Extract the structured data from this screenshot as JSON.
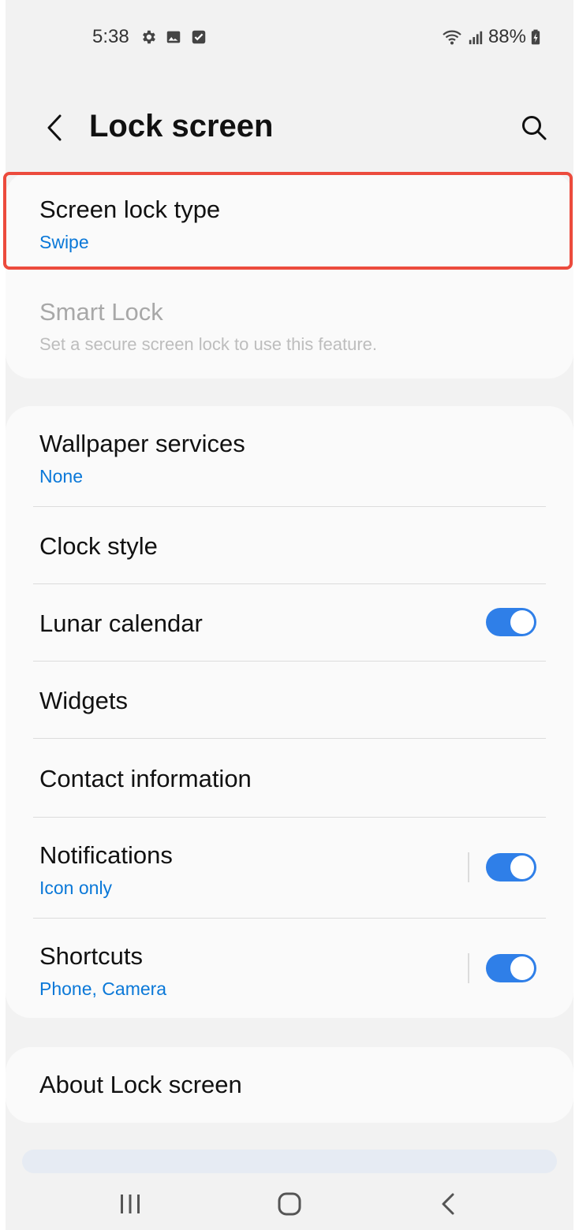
{
  "status": {
    "time": "5:38",
    "battery": "88%"
  },
  "header": {
    "title": "Lock screen"
  },
  "group1": {
    "screen_lock_type": {
      "title": "Screen lock type",
      "sub": "Swipe"
    },
    "smart_lock": {
      "title": "Smart Lock",
      "sub": "Set a secure screen lock to use this feature."
    }
  },
  "group2": {
    "wallpaper_services": {
      "title": "Wallpaper services",
      "sub": "None"
    },
    "clock_style": {
      "title": "Clock style"
    },
    "lunar_calendar": {
      "title": "Lunar calendar",
      "enabled": true
    },
    "widgets": {
      "title": "Widgets"
    },
    "contact_information": {
      "title": "Contact information"
    },
    "notifications": {
      "title": "Notifications",
      "sub": "Icon only",
      "enabled": true
    },
    "shortcuts": {
      "title": "Shortcuts",
      "sub": "Phone, Camera",
      "enabled": true
    }
  },
  "group3": {
    "about": {
      "title": "About Lock screen"
    }
  },
  "colors": {
    "accent_blue": "#0a78d8",
    "toggle_on": "#2f7fe8",
    "highlight_red": "#ec4b3d",
    "background": "#f2f2f2",
    "card": "#fafafa"
  }
}
